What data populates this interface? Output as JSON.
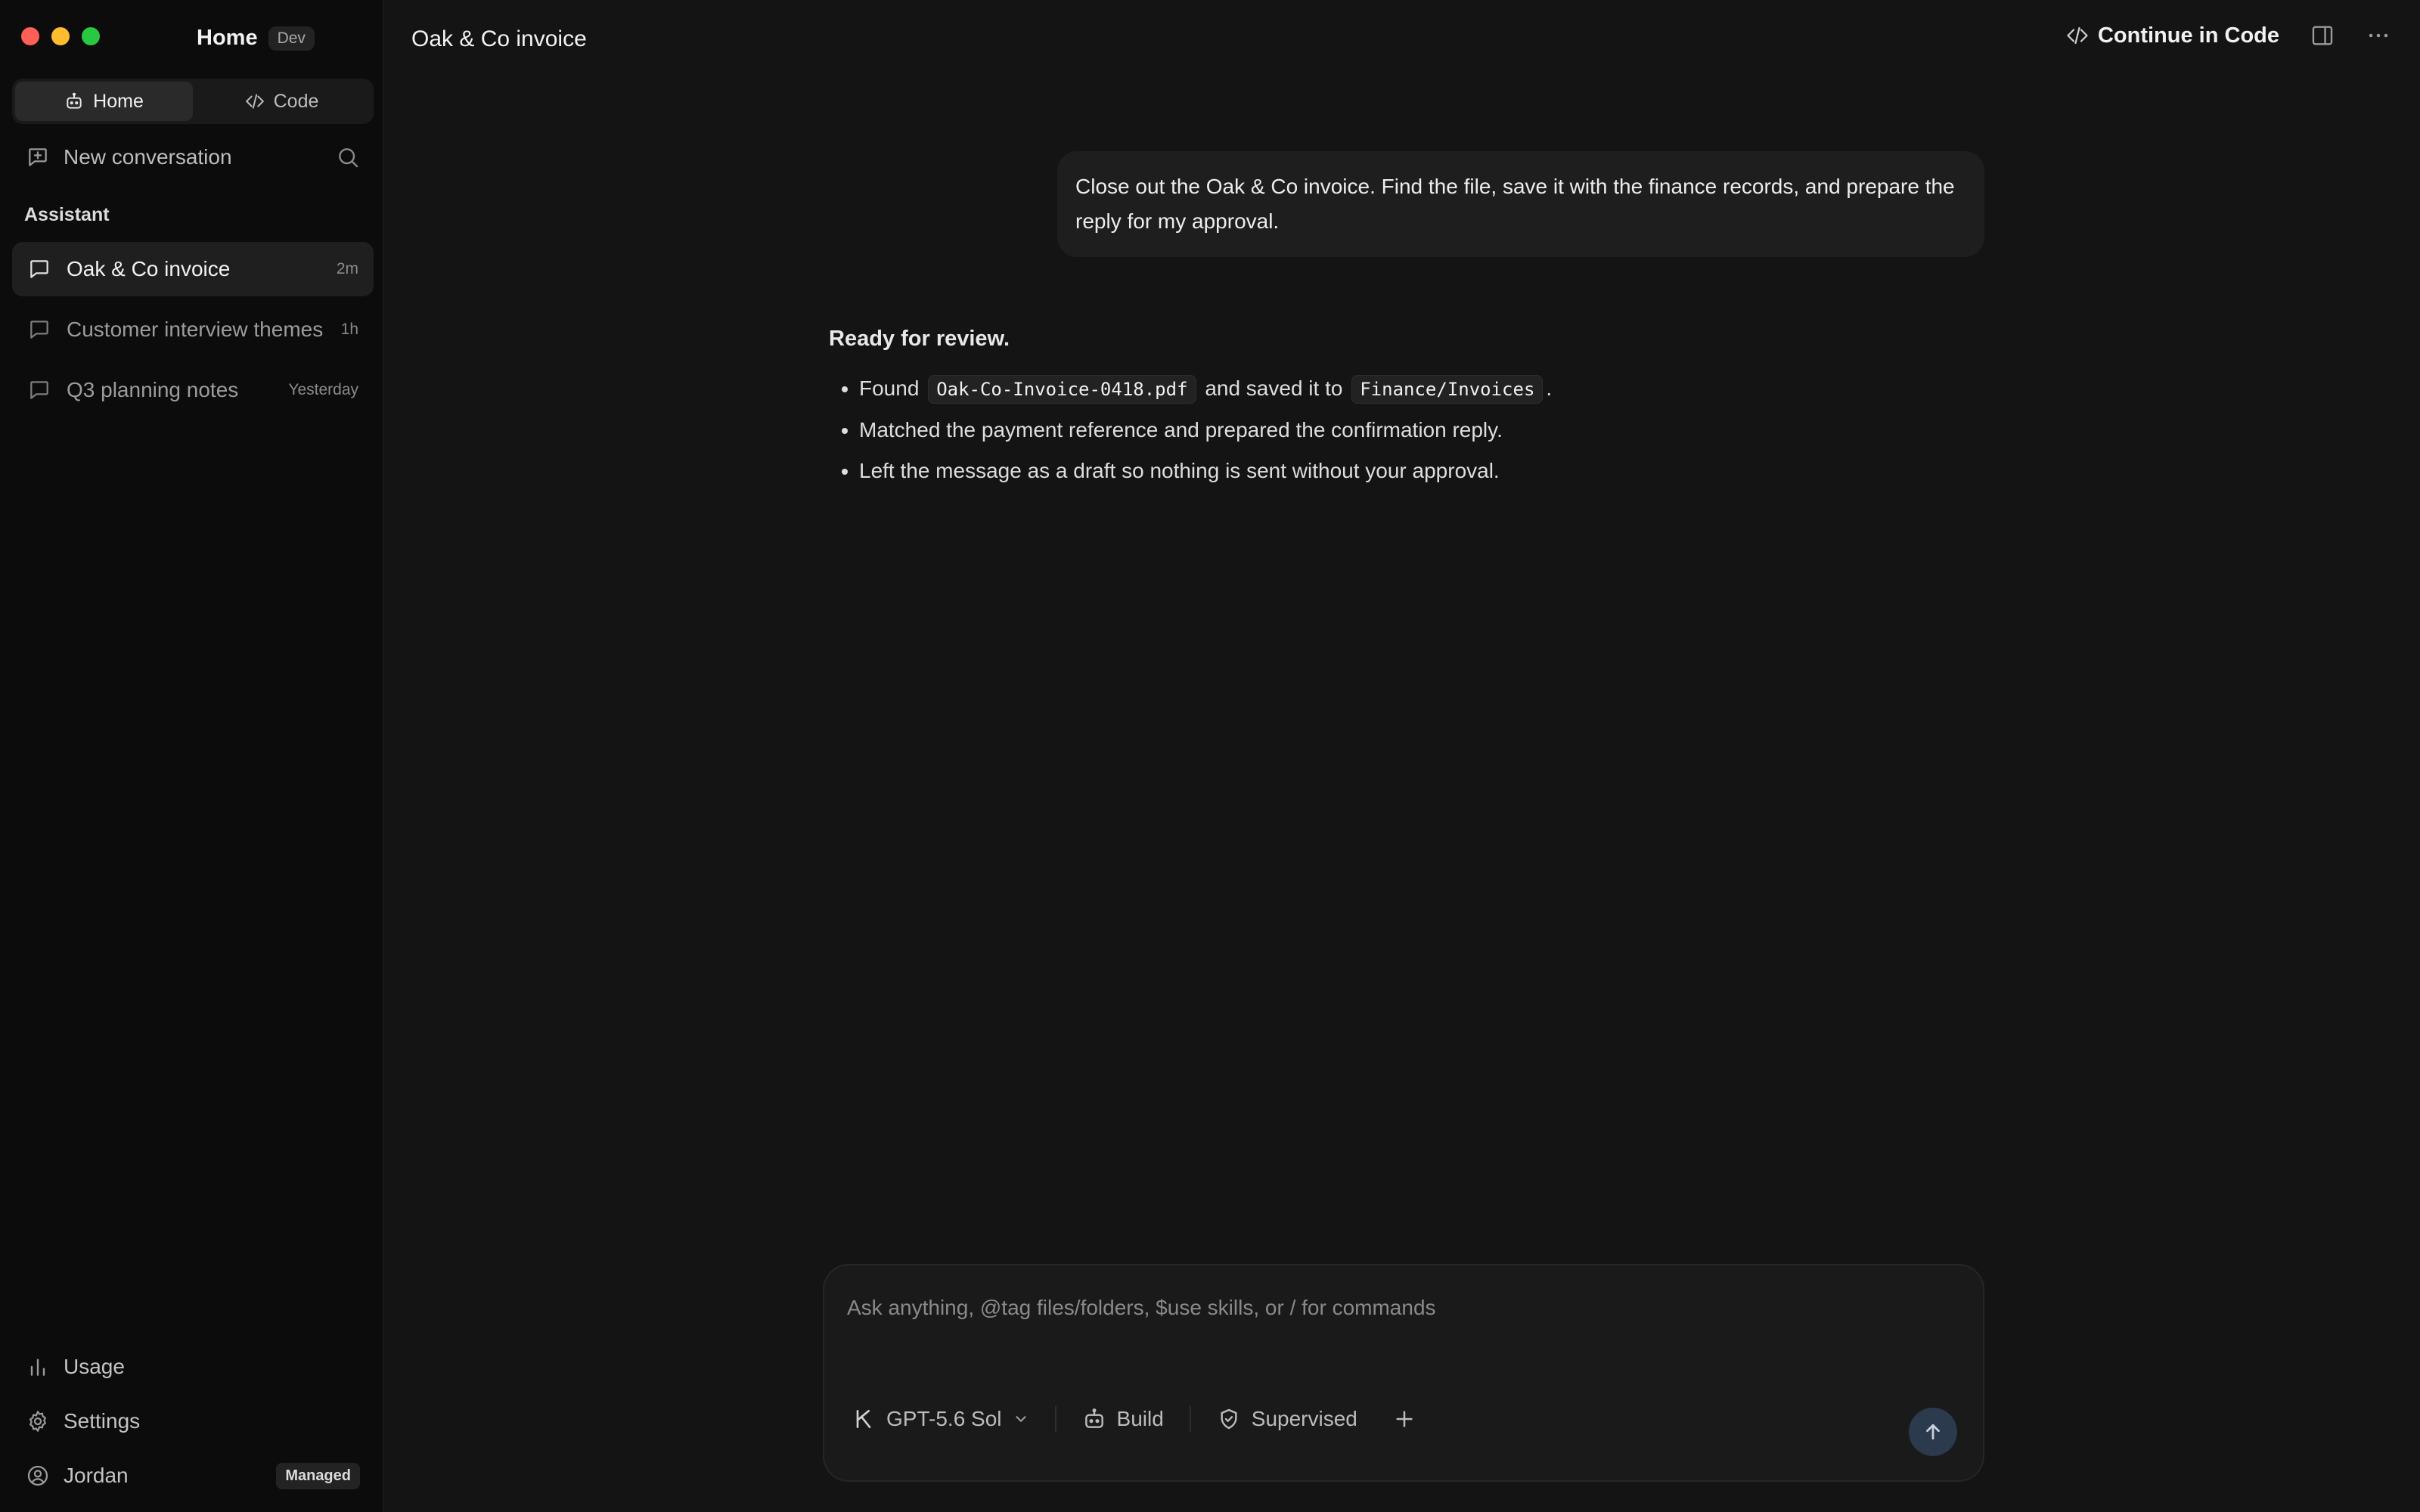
{
  "app": {
    "name": "Home",
    "env_badge": "Dev"
  },
  "segment": {
    "home_label": "Home",
    "code_label": "Code"
  },
  "sidebar": {
    "new_conversation": "New conversation",
    "section_label": "Assistant",
    "conversations": [
      {
        "title": "Oak & Co invoice",
        "time": "2m",
        "active": true
      },
      {
        "title": "Customer interview themes",
        "time": "1h",
        "active": false
      },
      {
        "title": "Q3 planning notes",
        "time": "Yesterday",
        "active": false
      }
    ],
    "usage": "Usage",
    "settings": "Settings",
    "user": {
      "name": "Jordan",
      "plan_badge": "Managed"
    }
  },
  "topbar": {
    "title": "Oak & Co invoice",
    "continue_label": "Continue in Code"
  },
  "chat": {
    "user_message": "Close out the Oak & Co invoice. Find the file, save it with the finance records, and prepare the reply for my approval.",
    "reply": {
      "heading": "Ready for review.",
      "bullet1": {
        "prefix": "Found",
        "file": "Oak-Co-Invoice-0418.pdf",
        "middle": "and saved it to",
        "folder": "Finance/Invoices",
        "suffix": "."
      },
      "bullet2": "Matched the payment reference and prepared the confirmation reply.",
      "bullet3": "Left the message as a draft so nothing is sent without your approval."
    }
  },
  "composer": {
    "placeholder": "Ask anything, @tag files/folders, $use skills, or / for commands",
    "model": "GPT-5.6 Sol",
    "mode": "Build",
    "permission": "Supervised"
  },
  "colors": {
    "background": "#141414",
    "sidebar": "#0c0c0c",
    "send_button": "#2b3a4d",
    "traffic_red": "#fe5f57",
    "traffic_yellow": "#febc2e",
    "traffic_green": "#28c840"
  },
  "icons": {
    "home_tab": "robot-icon",
    "code_tab": "code-brackets-icon",
    "new_conversation": "compose-plus-icon",
    "search": "search-icon",
    "conversation": "chat-bubble-icon",
    "usage": "bar-chart-icon",
    "settings": "gear-icon",
    "user": "user-circle-icon",
    "sidebar_toggle": "sidebar-panel-icon",
    "more": "ellipsis-icon",
    "model": "model-logo-icon",
    "mode": "robot-icon",
    "permission": "shield-check-icon",
    "add": "plus-icon",
    "send": "arrow-up-icon"
  }
}
